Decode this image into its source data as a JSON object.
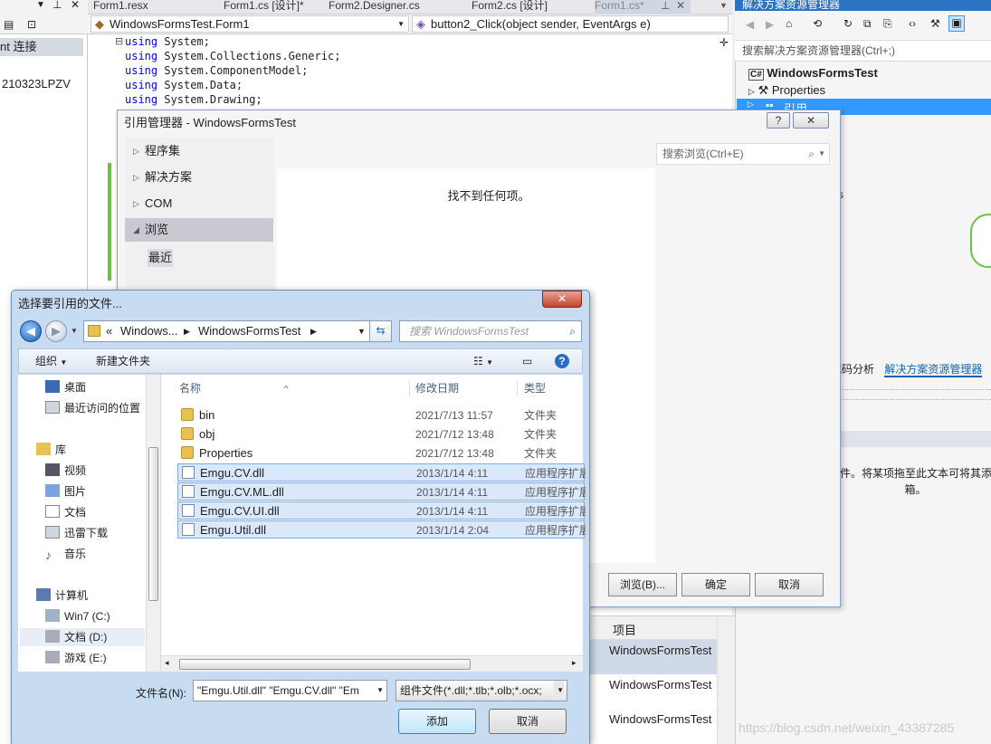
{
  "vs": {
    "left_panel": {
      "connect_label": "nt 连接",
      "machine_label": "210323LPZV"
    },
    "tabs": [
      "Form1.resx",
      "Form1.cs [设计]*",
      "Form2.Designer.cs",
      "Form2.cs [设计]",
      "Form1.cs*"
    ],
    "nav_class": "WindowsFormsTest.Form1",
    "nav_member": "button2_Click(object sender, EventArgs e)",
    "code_lines": [
      {
        "kw": "using",
        "rest": " System;"
      },
      {
        "kw": "using",
        "rest": " System.Collections.Generic;"
      },
      {
        "kw": "using",
        "rest": " System.ComponentModel;"
      },
      {
        "kw": "using",
        "rest": " System.Data;"
      },
      {
        "kw": "using",
        "rest": " System.Drawing;"
      }
    ],
    "solution_explorer": {
      "title": "解决方案资源管理器",
      "search_placeholder": "搜索解决方案资源管理器(Ctrl+;)",
      "project": "WindowsFormsTest",
      "properties": "Properties",
      "references": "引用",
      "tab_code_analysis": "代码分析",
      "tab_solution_explorer": "解决方案资源管理器",
      "toolbox_hint": "件。将某项拖至此文本可将其添加到工具箱。",
      "toolbox_hint_line1": "件。将某项拖至此文本可将其添",
      "toolbox_hint_line2": "箱。"
    },
    "bottom_list": {
      "header": "项目",
      "items": [
        "WindowsFormsTest",
        "WindowsFormsTest",
        "WindowsFormsTest"
      ]
    }
  },
  "ref_manager": {
    "title": "引用管理器 - WindowsFormsTest",
    "help_label": "?",
    "close_label": "✕",
    "categories": [
      "程序集",
      "解决方案",
      "COM",
      "浏览"
    ],
    "recent": "最近",
    "empty_message": "找不到任何项。",
    "search_placeholder": "搜索浏览(Ctrl+E)",
    "buttons": {
      "browse": "浏览(B)...",
      "ok": "确定",
      "cancel": "取消"
    }
  },
  "file_dialog": {
    "title": "选择要引用的文件...",
    "close_label": "✕",
    "address": {
      "prefix": "«",
      "segment1": "Windows...",
      "segment2": "WindowsFormsTest"
    },
    "search_placeholder": "搜索 WindowsFormsTest",
    "commands": {
      "organize": "组织",
      "new_folder": "新建文件夹"
    },
    "nav": {
      "favorites": [
        "桌面",
        "最近访问的位置"
      ],
      "library_header": "库",
      "libraries": [
        "视频",
        "图片",
        "文档",
        "迅雷下载",
        "音乐"
      ],
      "computer_header": "计算机",
      "drives": [
        "Win7 (C:)",
        "文档 (D:)",
        "游戏 (E:)"
      ]
    },
    "columns": {
      "name": "名称",
      "date": "修改日期",
      "type": "类型"
    },
    "files": [
      {
        "name": "bin",
        "date": "2021/7/13 11:57",
        "type": "文件夹",
        "kind": "folder",
        "selected": false
      },
      {
        "name": "obj",
        "date": "2021/7/12 13:48",
        "type": "文件夹",
        "kind": "folder",
        "selected": false
      },
      {
        "name": "Properties",
        "date": "2021/7/12 13:48",
        "type": "文件夹",
        "kind": "folder",
        "selected": false
      },
      {
        "name": "Emgu.CV.dll",
        "date": "2013/1/14 4:11",
        "type": "应用程序扩展",
        "kind": "dll",
        "selected": true
      },
      {
        "name": "Emgu.CV.ML.dll",
        "date": "2013/1/14 4:11",
        "type": "应用程序扩展",
        "kind": "dll",
        "selected": true
      },
      {
        "name": "Emgu.CV.UI.dll",
        "date": "2013/1/14 4:11",
        "type": "应用程序扩展",
        "kind": "dll",
        "selected": true
      },
      {
        "name": "Emgu.Util.dll",
        "date": "2013/1/14 2:04",
        "type": "应用程序扩展",
        "kind": "dll",
        "selected": true
      }
    ],
    "filename_label": "文件名(N):",
    "filename_value": "\"Emgu.Util.dll\" \"Emgu.CV.dll\" \"Em",
    "filter_value": "组件文件(*.dll;*.tlb;*.olb;*.ocx;",
    "buttons": {
      "add": "添加",
      "cancel": "取消"
    }
  },
  "watermark": "https://blog.csdn.net/weixin_43387285"
}
